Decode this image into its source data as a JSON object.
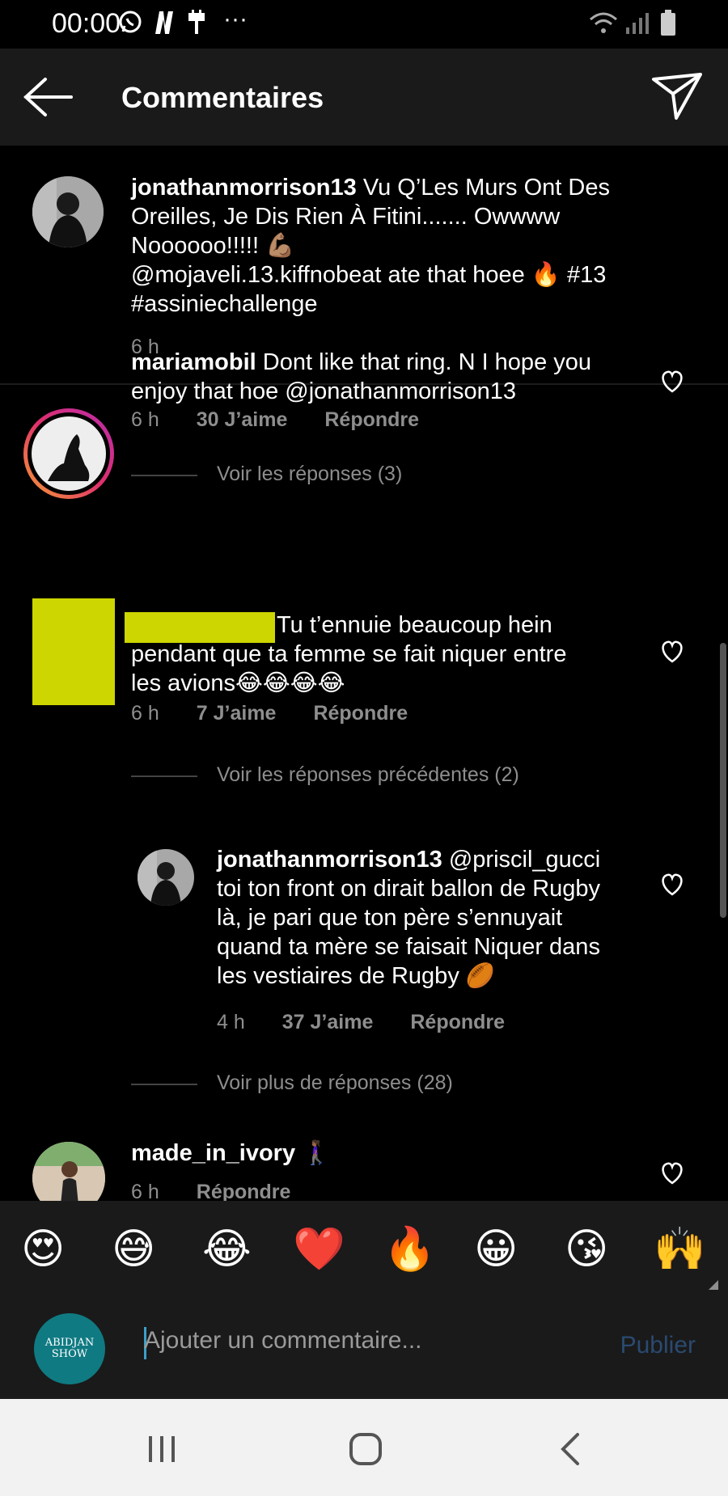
{
  "status_bar": {
    "time": "00:00",
    "icons": [
      "whatsapp-icon",
      "netflix-icon",
      "usb-icon",
      "more-icon",
      "wifi-icon",
      "signal-icon",
      "battery-icon"
    ],
    "more": "···"
  },
  "header": {
    "title": "Commentaires"
  },
  "caption": {
    "username": "jonathanmorrison13",
    "lines": [
      "Vu Q’Les Murs Ont Des",
      "Oreilles, Je Dis Rien À Fitini....... Owwww",
      "Noooooo!!!!! 💪🏽",
      "@mojaveli.13.kiffnobeat ate that hoee 🔥 #13",
      "#assiniechallenge"
    ],
    "time": "6 h"
  },
  "comments": [
    {
      "username": "mariamobil",
      "lines": [
        "Dont like that ring. N I hope you",
        "enjoy that hoe @jonathanmorrison13"
      ],
      "time": "6 h",
      "likes": "30 J’aime",
      "reply": "Répondre",
      "view_replies": "Voir les réponses (3)"
    },
    {
      "username": "",
      "lines": [
        "Tu t’ennuie beaucoup hein",
        "pendant que ta femme se fait niquer entre",
        "les avions😂😂😂😂"
      ],
      "time": "6 h",
      "likes": "7 J’aime",
      "reply": "Répondre",
      "view_previous": "Voir les réponses précédentes (2)"
    }
  ],
  "reply": {
    "username": "jonathanmorrison13",
    "lines": [
      "@priscil_gucci",
      "toi ton front on dirait ballon de Rugby",
      "là, je pari que ton père s’ennuyait",
      "quand ta mère se faisait Niquer dans",
      "les vestiaires de Rugby 🏉"
    ],
    "time": "4 h",
    "likes": "37 J’aime",
    "reply": "Répondre",
    "view_more": "Voir plus de réponses (28)"
  },
  "last_comment": {
    "username": "made_in_ivory",
    "emoji": "🚶🏾‍♀️",
    "time": "6 h",
    "reply": "Répondre"
  },
  "emoji_bar": [
    "😍",
    "😅",
    "😂",
    "❤️",
    "🔥",
    "😀",
    "😘",
    "🙌"
  ],
  "input": {
    "placeholder": "Ajouter un commentaire...",
    "publish": "Publier",
    "avatar_text": "ABIDJAN SHOW"
  },
  "colors": {
    "background": "#000000",
    "header": "#1a1a1a",
    "meta": "#8e8e8e",
    "publish": "#2a4a70",
    "redaction": "#cdd600"
  }
}
